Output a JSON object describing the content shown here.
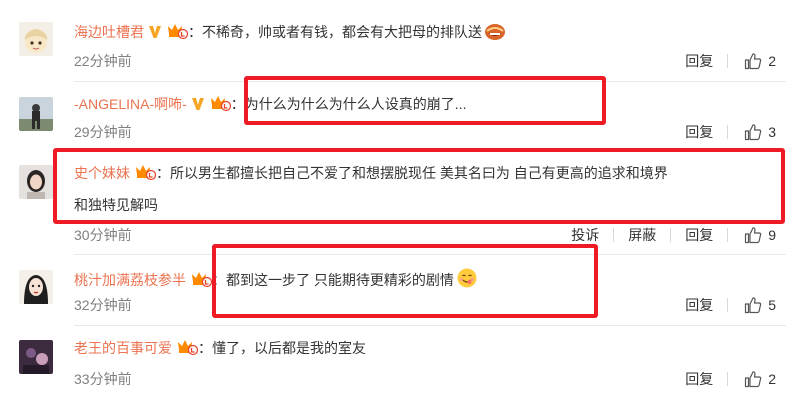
{
  "comments": [
    {
      "username": "海边吐槽君",
      "text": "不稀奇，帅或者有钱，都会有大把母的排队送",
      "time": "22分钟前",
      "reply_label": "回复",
      "likes": "2"
    },
    {
      "username": "-ANGELINA-啊咘-",
      "text": "为什么为什么为什么人设真的崩了...",
      "time": "29分钟前",
      "reply_label": "回复",
      "likes": "3"
    },
    {
      "username": "史个妹妹",
      "text_line1": "所以男生都擅长把自己不爱了和想摆脱现任   美其名曰为 自己有更高的追求和境界",
      "text_line2": "和独特见解吗",
      "time": "30分钟前",
      "report_label": "投诉",
      "block_label": "屏蔽",
      "reply_label": "回复",
      "likes": "9"
    },
    {
      "username": "桃汁加满荔枝参半",
      "text": "都到这一步了 只能期待更精彩的剧情",
      "time": "32分钟前",
      "reply_label": "回复",
      "likes": "5"
    },
    {
      "username": "老王的百事可爱",
      "text": "懂了，以后都是我的室友",
      "time": "33分钟前",
      "reply_label": "回复",
      "likes": "2"
    }
  ],
  "colon": "：",
  "colors": {
    "username": "#eb7350",
    "highlight_box": "#ef1b24",
    "time": "#808080"
  },
  "icons": {
    "verified": "verified-v-icon",
    "member": "member-crown-icon",
    "like": "thumbs-up-icon",
    "emoji_laugh": "laughing-emoji-icon",
    "emoji_yum": "yum-emoji-icon"
  }
}
